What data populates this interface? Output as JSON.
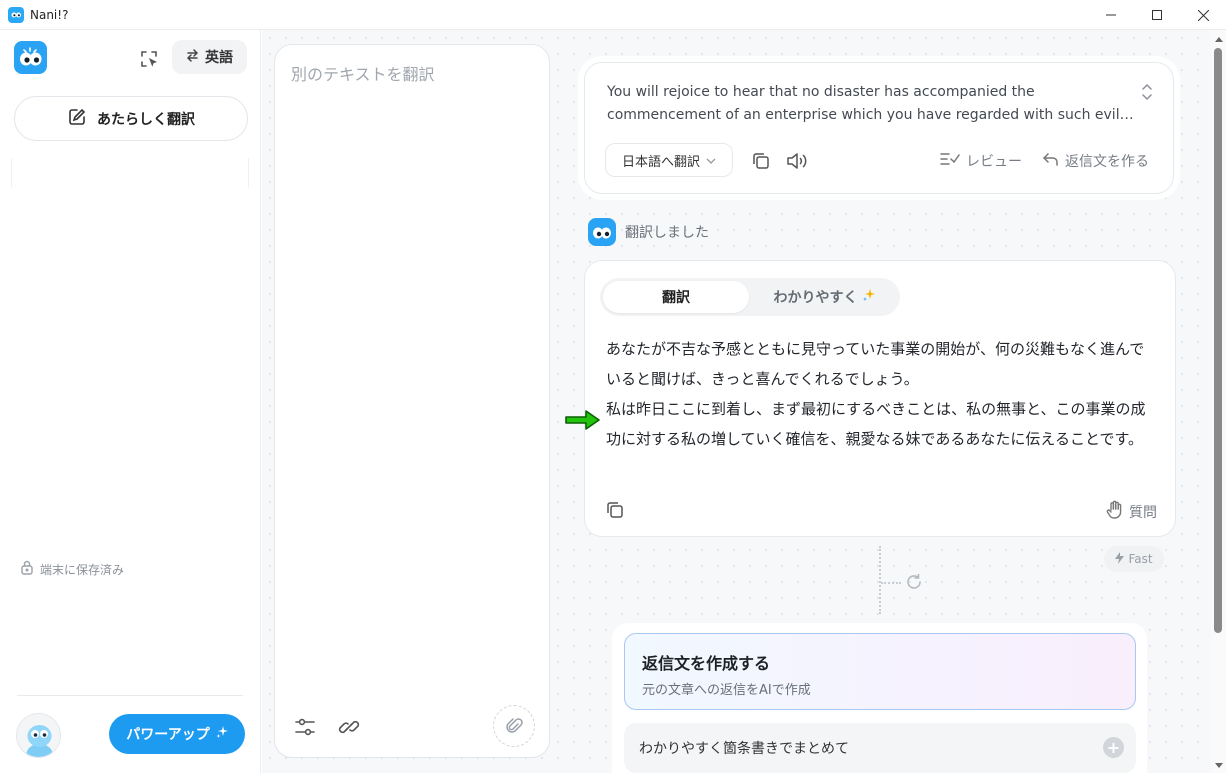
{
  "window": {
    "title": "Nani!?",
    "minimize": "—",
    "maximize": "☐",
    "close": "✕"
  },
  "sidebar": {
    "lang_label": "英語",
    "new_translation": "あたらしく翻訳",
    "saved_label": "端末に保存済み",
    "power_up": "パワーアップ"
  },
  "input": {
    "placeholder": "別のテキストを翻訳"
  },
  "source": {
    "text": "You will rejoice to hear that no disaster has accompanied the commencement of an enterprise which you have regarded with such evil forebodings.",
    "target_label": "日本語へ翻訳",
    "review_label": "レビュー",
    "reply_label": "返信文を作る"
  },
  "status": {
    "label": "翻訳しました"
  },
  "result": {
    "tabs": [
      "翻訳",
      "わかりやすく"
    ],
    "paragraph_1": "あなたが不吉な予感とともに見守っていた事業の開始が、何の災難もなく進んでいると聞けば、きっと喜んでくれるでしょう。",
    "paragraph_2": "私は昨日ここに到着し、まず最初にするべきことは、私の無事と、この事業の成功に対する私の増していく確信を、親愛なる妹であるあなたに伝えることです。",
    "ask_label": "質問"
  },
  "meta": {
    "fast_label": "Fast"
  },
  "compose": {
    "title": "返信文を作成する",
    "subtitle": "元の文章への返信をAIで作成",
    "suggestion": "わかりやすく箇条書きでまとめて",
    "plus": "+"
  },
  "colors": {
    "accent": "#1d9bf0",
    "logo": "#2aa3f4",
    "arrow": "#22c40c"
  },
  "icons": [
    "app-icon",
    "crop-icon",
    "swap-icon",
    "edit-icon",
    "lock-icon",
    "settings-icon",
    "link-icon",
    "attach-icon",
    "expand-icon",
    "chevron-down-icon",
    "copy-icon",
    "speaker-icon",
    "review-icon",
    "reply-icon",
    "sparkle-icon",
    "hand-icon",
    "bolt-icon",
    "refresh-icon",
    "plus-icon"
  ]
}
